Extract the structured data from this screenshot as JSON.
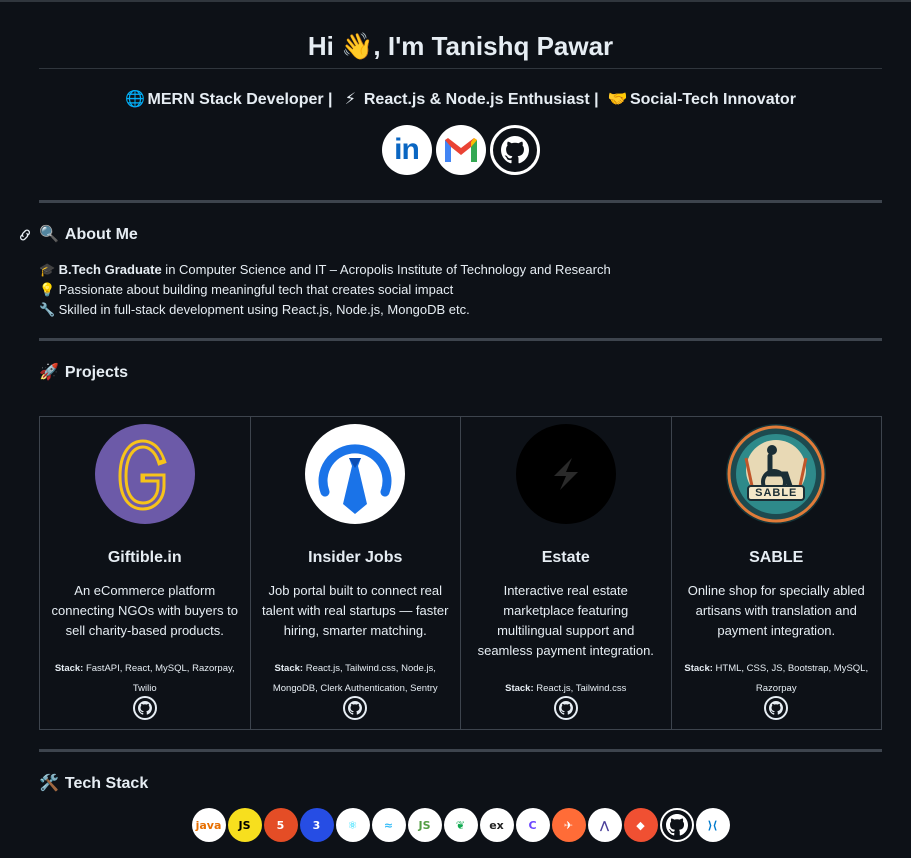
{
  "header": {
    "title": "Hi 👋, I'm Tanishq Pawar",
    "subtitle_parts": [
      {
        "emoji": "🌐",
        "text": "MERN Stack Developer |"
      },
      {
        "emoji": "⚡",
        "text": "React.js & Node.js Enthusiast |"
      },
      {
        "emoji": "🤝",
        "text": "Social-Tech Innovator"
      }
    ],
    "socials": [
      {
        "name": "linkedin",
        "icon": "linkedin-icon",
        "label": "in"
      },
      {
        "name": "gmail",
        "icon": "gmail-icon",
        "label": "M"
      },
      {
        "name": "github",
        "icon": "github-icon"
      }
    ]
  },
  "about": {
    "emoji": "🔍",
    "heading": "About Me",
    "items": [
      {
        "emoji": "🎓",
        "bold": "B.Tech Graduate",
        "text": " in Computer Science and IT – Acropolis Institute of Technology and Research"
      },
      {
        "emoji": "💡",
        "bold": "",
        "text": "Passionate about building meaningful tech that creates social impact"
      },
      {
        "emoji": "🔧",
        "bold": "",
        "text": "Skilled in full-stack development using React.js, Node.js, MongoDB etc."
      }
    ]
  },
  "projects": {
    "emoji": "🚀",
    "heading": "Projects",
    "stack_label": "Stack:",
    "items": [
      {
        "name": "Giftible.in",
        "logo": "giftible-logo",
        "desc": "An eCommerce platform connecting NGOs with buyers to sell charity-based products.",
        "stack": "FastAPI, React, MySQL, Razorpay, Twilio"
      },
      {
        "name": "Insider Jobs",
        "logo": "insider-jobs-logo",
        "desc": "Job portal built to connect real talent with real startups — faster hiring, smarter matching.",
        "stack": "React.js, Tailwind.css, Node.js, MongoDB, Clerk Authentication, Sentry"
      },
      {
        "name": "Estate",
        "logo": "estate-logo",
        "desc": "Interactive real estate marketplace featuring multilingual support and seamless payment integration.",
        "stack": "React.js, Tailwind.css"
      },
      {
        "name": "SABLE",
        "logo": "sable-logo",
        "logo_text": "SABLE",
        "desc": "Online shop for specially abled artisans with translation and payment integration.",
        "stack": "HTML, CSS, JS, Bootstrap, MySQL, Razorpay"
      }
    ]
  },
  "tech": {
    "emoji": "🛠️",
    "heading": "Tech Stack",
    "icons": [
      {
        "name": "java-icon",
        "label": "java",
        "bg": "#ffffff",
        "fg": "#e76f00"
      },
      {
        "name": "javascript-icon",
        "label": "JS",
        "bg": "#f7df1e",
        "fg": "#000000"
      },
      {
        "name": "html5-icon",
        "label": "5",
        "bg": "#e44d26",
        "fg": "#ffffff"
      },
      {
        "name": "css3-icon",
        "label": "3",
        "bg": "#264de4",
        "fg": "#ffffff"
      },
      {
        "name": "react-icon",
        "label": "⚛",
        "bg": "#ffffff",
        "fg": "#00d8ff"
      },
      {
        "name": "tailwind-icon",
        "label": "≈",
        "bg": "#ffffff",
        "fg": "#38bdf8"
      },
      {
        "name": "nodejs-icon",
        "label": "JS",
        "bg": "#ffffff",
        "fg": "#539e43"
      },
      {
        "name": "mongodb-icon",
        "label": "❦",
        "bg": "#ffffff",
        "fg": "#13aa52"
      },
      {
        "name": "express-icon",
        "label": "ex",
        "bg": "#ffffff",
        "fg": "#222222"
      },
      {
        "name": "clerk-icon",
        "label": "C",
        "bg": "#ffffff",
        "fg": "#6c47ff"
      },
      {
        "name": "postman-icon",
        "label": "✈",
        "bg": "#ff6c37",
        "fg": "#ffffff"
      },
      {
        "name": "render-icon",
        "label": "⋀",
        "bg": "#ffffff",
        "fg": "#4b3f9a"
      },
      {
        "name": "git-icon",
        "label": "◆",
        "bg": "#f05032",
        "fg": "#ffffff"
      },
      {
        "name": "github-icon",
        "label": "",
        "bg": "#0d1117",
        "fg": "#ffffff"
      },
      {
        "name": "vscode-icon",
        "label": "⟩⟨",
        "bg": "#ffffff",
        "fg": "#007acc"
      }
    ]
  },
  "colors": {
    "background": "#0d1117",
    "text": "#e6edf3",
    "rule": "#3d444d"
  }
}
